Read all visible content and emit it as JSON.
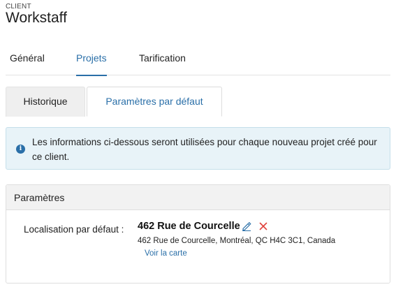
{
  "header": {
    "eyebrow": "CLIENT",
    "title": "Workstaff"
  },
  "main_tabs": [
    {
      "label": "Général",
      "active": false
    },
    {
      "label": "Projets",
      "active": true
    },
    {
      "label": "Tarification",
      "active": false
    }
  ],
  "sub_tabs": [
    {
      "label": "Historique",
      "active": false
    },
    {
      "label": "Paramètres par défaut",
      "active": true
    }
  ],
  "info": {
    "icon": "info-icon",
    "text": "Les informations ci-dessous seront utilisées pour chaque nouveau projet créé pour ce client."
  },
  "panel": {
    "title": "Paramètres",
    "location_label": "Localisation par défaut :",
    "location_name": "462 Rue de Courcelle",
    "location_address": "462 Rue de Courcelle, Montréal, QC H4C 3C1, Canada",
    "map_link": "Voir la carte",
    "edit_icon": "pencil-icon",
    "delete_icon": "close-icon"
  },
  "colors": {
    "accent": "#2a6fa8",
    "info_bg": "#e8f3f8",
    "delete": "#e0403a"
  }
}
